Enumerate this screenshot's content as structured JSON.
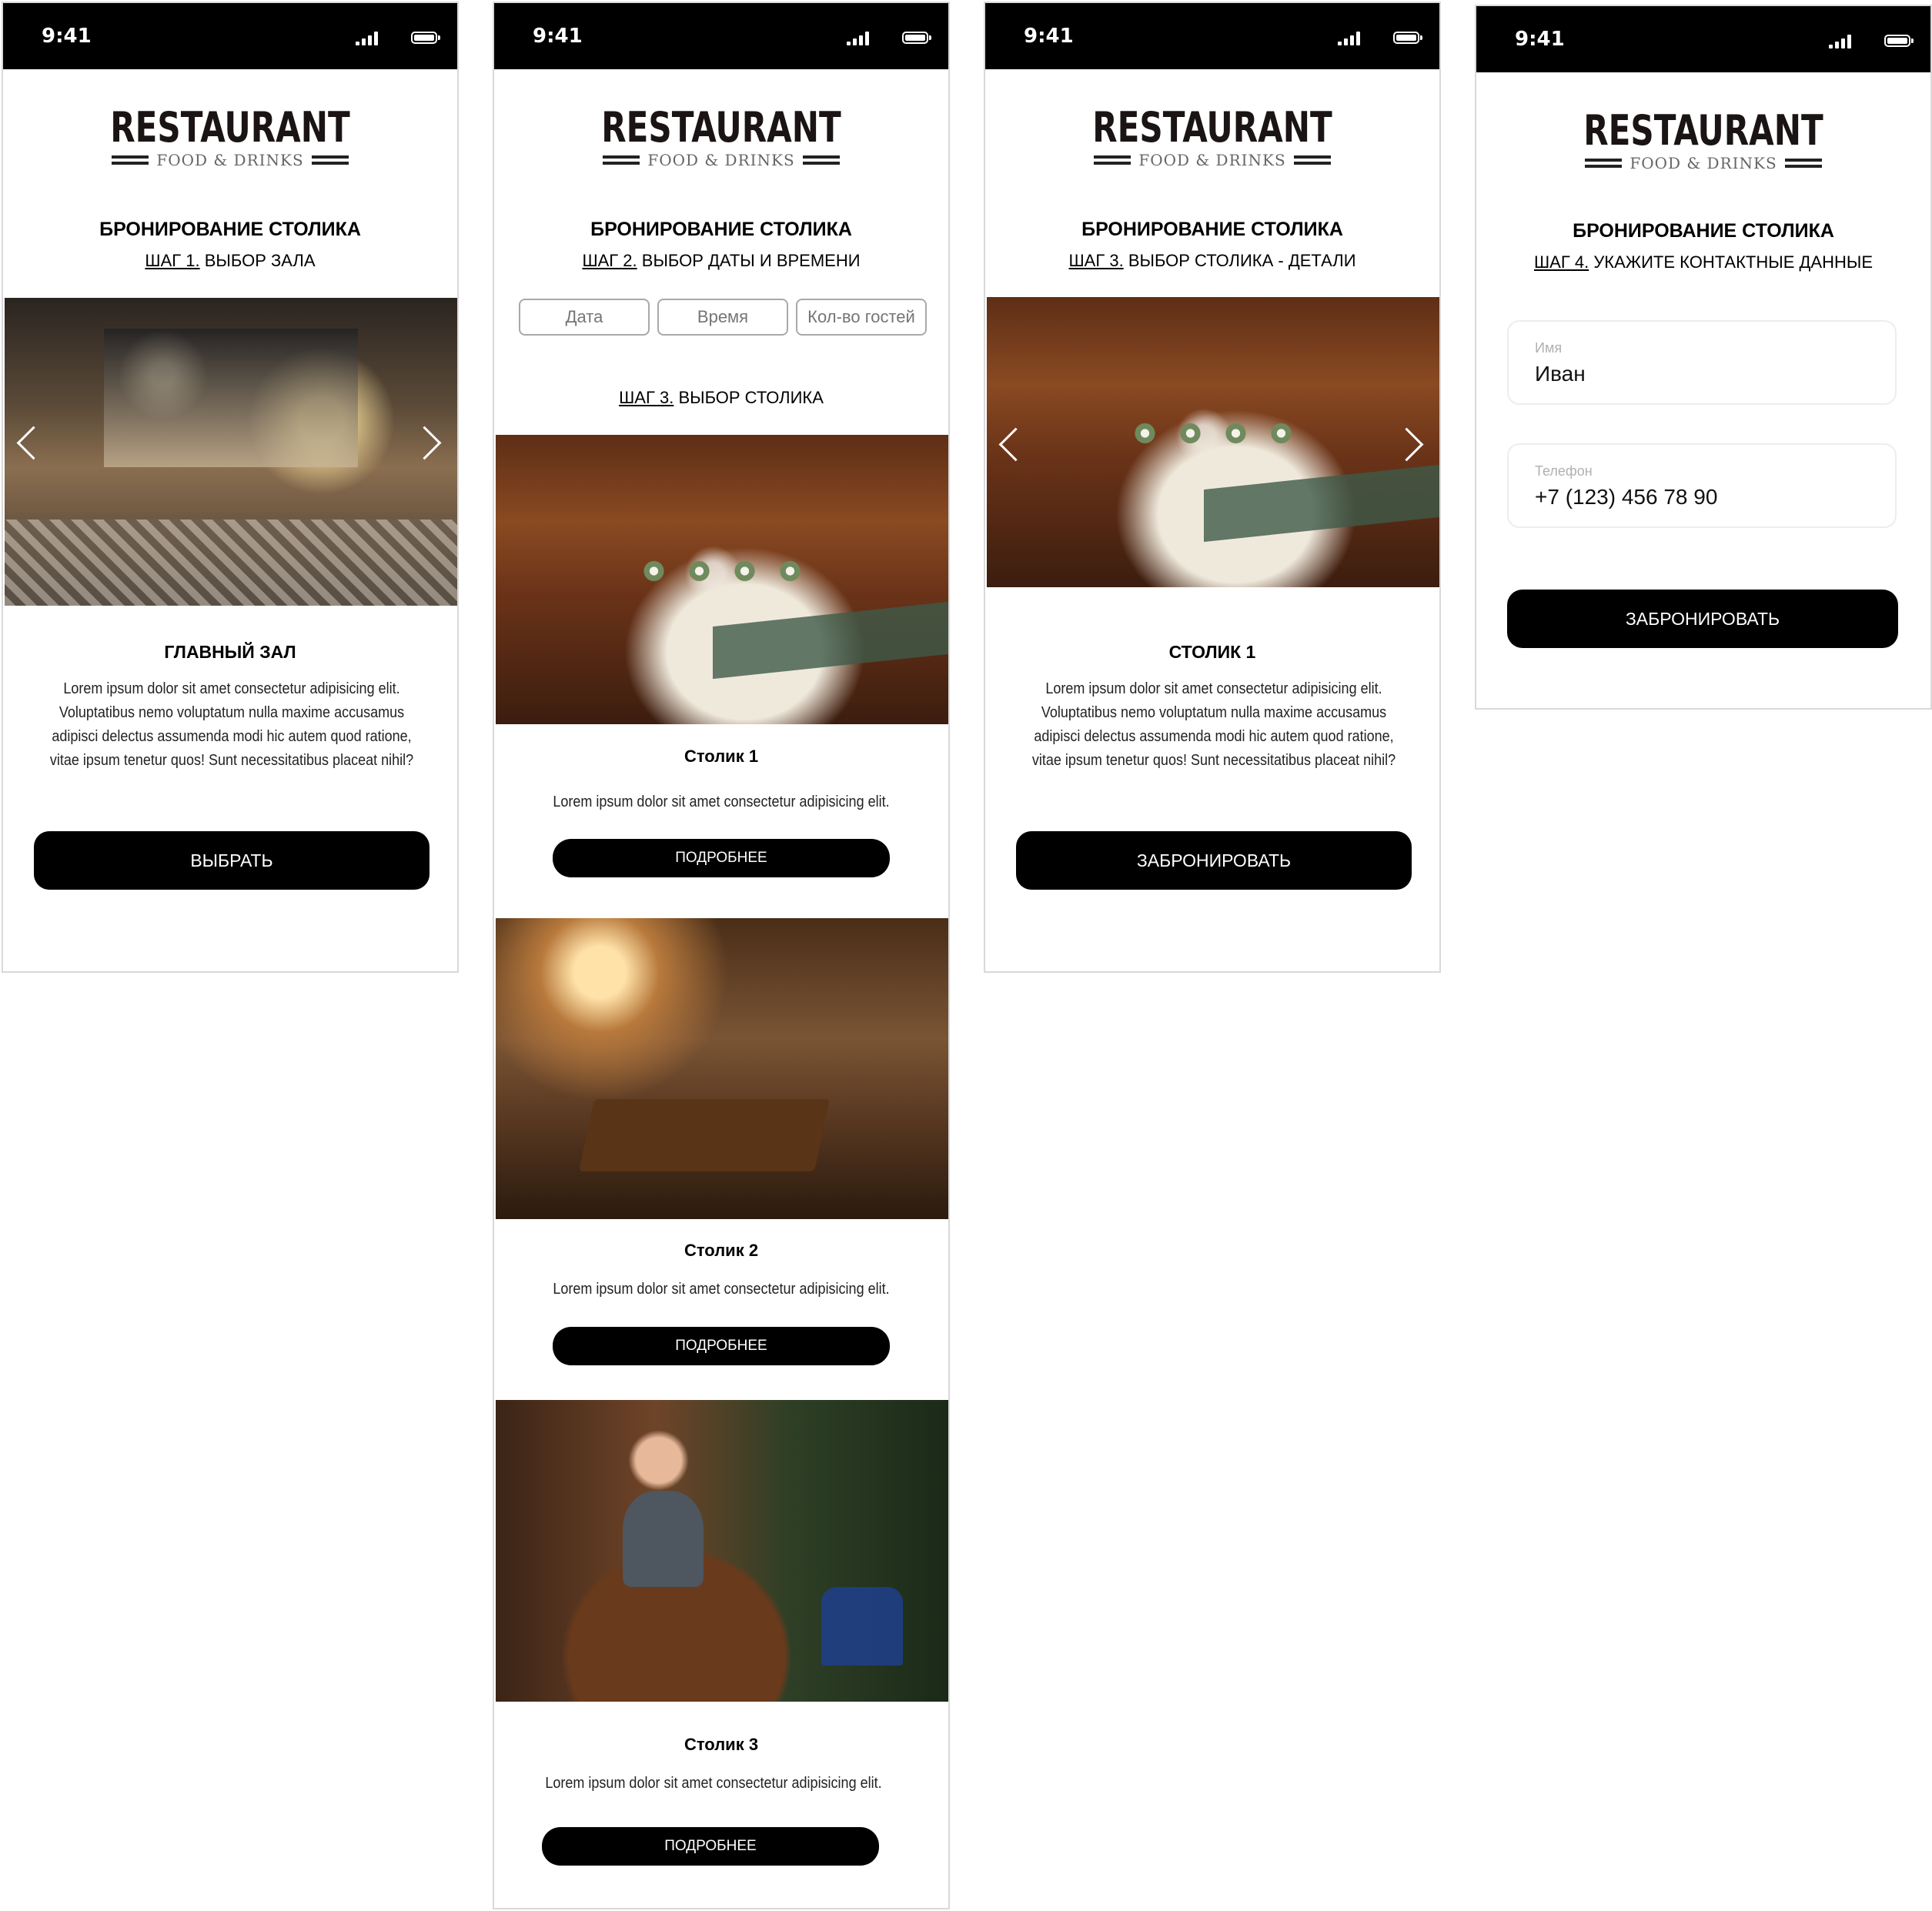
{
  "status_time": "9:41",
  "logo": {
    "name": "RESTAURANT",
    "sub": "FOOD & DRINKS"
  },
  "booking_title": "БРОНИРОВАНИЕ СТОЛИКА",
  "screen1": {
    "step_label": "ШАГ 1.",
    "step_text": " ВЫБОР ЗАЛА",
    "hall_title": "ГЛАВНЫЙ ЗАЛ",
    "description": "Lorem ipsum dolor sit amet consectetur adipisicing elit. Voluptatibus nemo voluptatum nulla maxime accusamus adipisci delectus assumenda modi hic autem quod ratione, vitae ipsum tenetur quos! Sunt necessitatibus placeat nihil?",
    "button": "ВЫБРАТЬ"
  },
  "screen2": {
    "step_label": "ШАГ 2.",
    "step_text": " ВЫБОР ДАТЫ И ВРЕМЕНИ",
    "date_placeholder": "Дата",
    "time_placeholder": "Время",
    "guests_placeholder": "Кол-во гостей",
    "step3_label": "ШАГ 3.",
    "step3_text": " ВЫБОР СТОЛИКА",
    "tables": [
      {
        "name": "Столик 1",
        "text": "Lorem ipsum dolor sit amet consectetur adipisicing elit.",
        "button": "ПОДРОБНЕЕ"
      },
      {
        "name": "Столик 2",
        "text": "Lorem ipsum dolor sit amet consectetur adipisicing elit.",
        "button": "ПОДРОБНЕЕ"
      },
      {
        "name": "Столик 3",
        "text": "Lorem ipsum dolor sit amet consectetur adipisicing elit.",
        "button": "ПОДРОБНЕЕ"
      }
    ]
  },
  "screen3": {
    "step_label": "ШАГ 3.",
    "step_text": " ВЫБОР СТОЛИКА - ДЕТАЛИ",
    "table_title": "СТОЛИК 1",
    "description": "Lorem ipsum dolor sit amet consectetur adipisicing elit. Voluptatibus nemo voluptatum nulla maxime accusamus adipisci delectus assumenda modi hic autem quod ratione, vitae ipsum tenetur quos! Sunt necessitatibus placeat nihil?",
    "button": "ЗАБРОНИРОВАТЬ"
  },
  "screen4": {
    "step_label": "ШАГ 4.",
    "step_text": " УКАЖИТЕ КОНТАКТНЫЕ ДАННЫЕ",
    "name_label": "Имя",
    "name_value": "Иван",
    "phone_label": "Телефон",
    "phone_value": "+7 (123) 456 78 90",
    "button": "ЗАБРОНИРОВАТЬ"
  },
  "icons": [
    "signal-icon",
    "battery-icon",
    "chevron-left-icon",
    "chevron-right-icon"
  ],
  "colors": {
    "background": "#ffffff",
    "statusbar": "#000000",
    "button": "#000000",
    "button_text": "#ffffff",
    "border": "#d9d9d9"
  }
}
